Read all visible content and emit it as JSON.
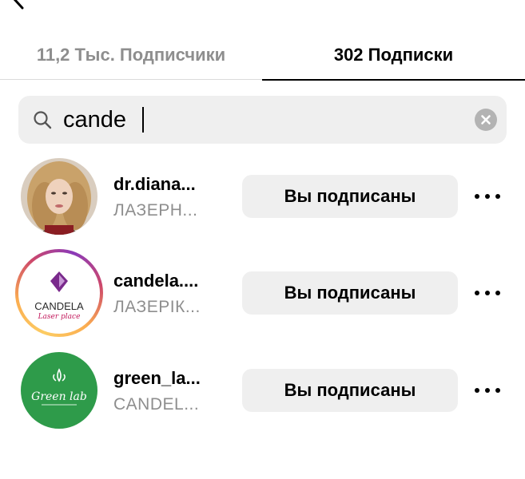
{
  "tabs": {
    "followers_label": "11,2 Тыс. Подписчики",
    "following_label": "302 Подписки",
    "active": "following"
  },
  "search": {
    "value": "cande",
    "clear_icon": "clear-icon",
    "search_icon": "search-icon"
  },
  "list": [
    {
      "username": "dr.diana...",
      "full_name": "ЛАЗЕРН...",
      "button_label": "Вы подписаны",
      "has_story_ring": false
    },
    {
      "username": "candela....",
      "full_name": "ЛАЗЕРІК...",
      "button_label": "Вы подписаны",
      "has_story_ring": true,
      "avatar_logo_text": "CANDELA",
      "avatar_logo_subtext": "Laser place"
    },
    {
      "username": "green_la...",
      "full_name": "CANDEL...",
      "button_label": "Вы подписаны",
      "has_story_ring": false,
      "avatar_logo_text": "Green lab"
    }
  ],
  "colors": {
    "inactive_tab": "#8e8e8e",
    "button_bg": "#efefef",
    "search_bg": "#efefef",
    "green_avatar": "#2e9b4a",
    "candela_purple": "#7a2a8c"
  }
}
